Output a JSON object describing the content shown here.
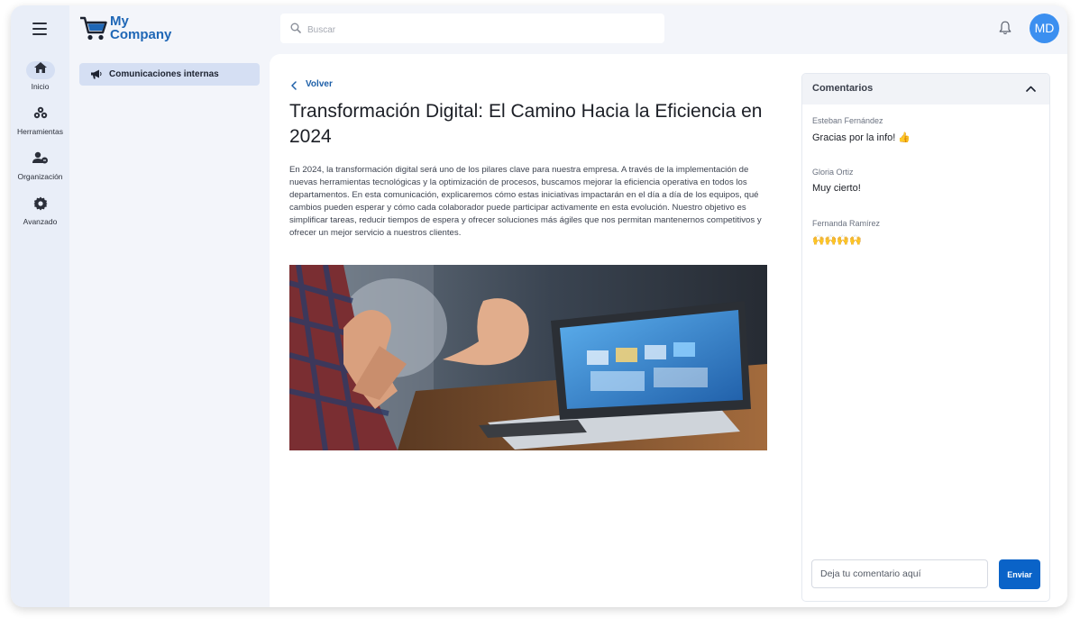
{
  "brand": {
    "line1": "My",
    "line2": "Company",
    "color": "#1f67b6"
  },
  "search": {
    "placeholder": "Buscar"
  },
  "user": {
    "initials": "MD"
  },
  "nav": {
    "items": [
      {
        "label": "Inicio",
        "icon": "home-icon",
        "active": true
      },
      {
        "label": "Herramientas",
        "icon": "tools-icon"
      },
      {
        "label": "Organización",
        "icon": "users-icon"
      },
      {
        "label": "Avanzado",
        "icon": "gear-icon"
      }
    ]
  },
  "subnav": {
    "label": "Comunicaciones internas",
    "icon": "megaphone-icon"
  },
  "article": {
    "back_label": "Volver",
    "title": "Transformación Digital: El Camino Hacia la Eficiencia en 2024",
    "body": "En 2024, la transformación digital será uno de los pilares clave para nuestra empresa. A través de la implementación de nuevas herramientas tecnológicas y la optimización de procesos, buscamos mejorar la eficiencia operativa en todos los departamentos. En esta comunicación, explicaremos cómo estas iniciativas impactarán en el día a día de los equipos, qué cambios pueden esperar y cómo cada colaborador puede participar activamente en esta evolución. Nuestro objetivo es simplificar tareas, reducir tiempos de espera y ofrecer soluciones más ágiles que nos permitan mantenernos competitivos y ofrecer un mejor servicio a nuestros clientes."
  },
  "comments": {
    "title": "Comentarios",
    "items": [
      {
        "author": "Esteban Fernández",
        "text": "Gracias por la info! 👍"
      },
      {
        "author": "Gloria Ortiz",
        "text": "Muy cierto!"
      },
      {
        "author": "Fernanda Ramírez",
        "text": "🙌🙌🙌🙌"
      }
    ],
    "input_placeholder": "Deja tu comentario aquí",
    "send_label": "Enviar"
  },
  "colors": {
    "accent": "#0a63c8",
    "avatar": "#3b8ff0",
    "rail_bg": "#e9eef8",
    "active_bg": "#d5dff3"
  }
}
